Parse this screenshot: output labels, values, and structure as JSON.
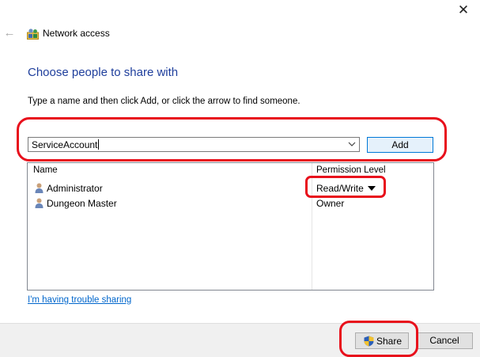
{
  "window": {
    "title": "Network access",
    "close_icon": "close-icon",
    "back_icon": "back-arrow-icon",
    "app_icon": "network-users-icon"
  },
  "main": {
    "heading": "Choose people to share with",
    "instructions": "Type a name and then click Add, or click the arrow to find someone.",
    "name_input": {
      "value": "ServiceAccount",
      "dropdown_icon": "chevron-down-icon"
    },
    "add_label": "Add",
    "list": {
      "columns": {
        "name": "Name",
        "permission": "Permission Level"
      },
      "rows": [
        {
          "name": "Administrator",
          "permission": "Read/Write",
          "has_dropdown": true,
          "icon": "user-icon"
        },
        {
          "name": "Dungeon Master",
          "permission": "Owner",
          "has_dropdown": false,
          "icon": "user-icon"
        }
      ]
    },
    "trouble_link": "I'm having trouble sharing"
  },
  "footer": {
    "share_label": "Share",
    "share_icon": "uac-shield-icon",
    "cancel_label": "Cancel"
  },
  "colors": {
    "heading": "#1e3e9c",
    "link": "#0066cc",
    "annotation": "#e8101c",
    "add_button_border": "#0078d7"
  }
}
